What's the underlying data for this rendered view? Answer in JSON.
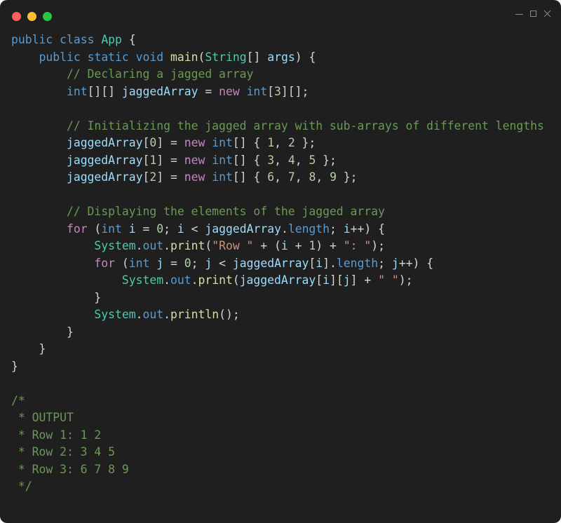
{
  "window": {
    "controls": {
      "close_color": "#ff5f57",
      "minimize_color": "#febc2e",
      "maximize_color": "#28c840"
    }
  },
  "code": {
    "language": "java",
    "lines": [
      [
        {
          "t": "public",
          "c": "kw"
        },
        {
          "t": " "
        },
        {
          "t": "class",
          "c": "kw"
        },
        {
          "t": " "
        },
        {
          "t": "App",
          "c": "type"
        },
        {
          "t": " {"
        }
      ],
      [
        {
          "t": "    "
        },
        {
          "t": "public",
          "c": "kw"
        },
        {
          "t": " "
        },
        {
          "t": "static",
          "c": "kw"
        },
        {
          "t": " "
        },
        {
          "t": "void",
          "c": "kw"
        },
        {
          "t": " "
        },
        {
          "t": "main",
          "c": "fn"
        },
        {
          "t": "("
        },
        {
          "t": "String",
          "c": "type"
        },
        {
          "t": "[] "
        },
        {
          "t": "args",
          "c": "var"
        },
        {
          "t": ") {"
        }
      ],
      [
        {
          "t": "        "
        },
        {
          "t": "// Declaring a jagged array",
          "c": "cm"
        }
      ],
      [
        {
          "t": "        "
        },
        {
          "t": "int",
          "c": "kw"
        },
        {
          "t": "[][] "
        },
        {
          "t": "jaggedArray",
          "c": "var"
        },
        {
          "t": " = "
        },
        {
          "t": "new",
          "c": "ctl"
        },
        {
          "t": " "
        },
        {
          "t": "int",
          "c": "kw"
        },
        {
          "t": "["
        },
        {
          "t": "3",
          "c": "num"
        },
        {
          "t": "][];"
        }
      ],
      [
        {
          "t": ""
        }
      ],
      [
        {
          "t": "        "
        },
        {
          "t": "// Initializing the jagged array with sub-arrays of different lengths",
          "c": "cm"
        }
      ],
      [
        {
          "t": "        "
        },
        {
          "t": "jaggedArray",
          "c": "var"
        },
        {
          "t": "["
        },
        {
          "t": "0",
          "c": "num"
        },
        {
          "t": "] = "
        },
        {
          "t": "new",
          "c": "ctl"
        },
        {
          "t": " "
        },
        {
          "t": "int",
          "c": "kw"
        },
        {
          "t": "[] { "
        },
        {
          "t": "1",
          "c": "num"
        },
        {
          "t": ", "
        },
        {
          "t": "2",
          "c": "num"
        },
        {
          "t": " };"
        }
      ],
      [
        {
          "t": "        "
        },
        {
          "t": "jaggedArray",
          "c": "var"
        },
        {
          "t": "["
        },
        {
          "t": "1",
          "c": "num"
        },
        {
          "t": "] = "
        },
        {
          "t": "new",
          "c": "ctl"
        },
        {
          "t": " "
        },
        {
          "t": "int",
          "c": "kw"
        },
        {
          "t": "[] { "
        },
        {
          "t": "3",
          "c": "num"
        },
        {
          "t": ", "
        },
        {
          "t": "4",
          "c": "num"
        },
        {
          "t": ", "
        },
        {
          "t": "5",
          "c": "num"
        },
        {
          "t": " };"
        }
      ],
      [
        {
          "t": "        "
        },
        {
          "t": "jaggedArray",
          "c": "var"
        },
        {
          "t": "["
        },
        {
          "t": "2",
          "c": "num"
        },
        {
          "t": "] = "
        },
        {
          "t": "new",
          "c": "ctl"
        },
        {
          "t": " "
        },
        {
          "t": "int",
          "c": "kw"
        },
        {
          "t": "[] { "
        },
        {
          "t": "6",
          "c": "num"
        },
        {
          "t": ", "
        },
        {
          "t": "7",
          "c": "num"
        },
        {
          "t": ", "
        },
        {
          "t": "8",
          "c": "num"
        },
        {
          "t": ", "
        },
        {
          "t": "9",
          "c": "num"
        },
        {
          "t": " };"
        }
      ],
      [
        {
          "t": ""
        }
      ],
      [
        {
          "t": "        "
        },
        {
          "t": "// Displaying the elements of the jagged array",
          "c": "cm"
        }
      ],
      [
        {
          "t": "        "
        },
        {
          "t": "for",
          "c": "ctl"
        },
        {
          "t": " ("
        },
        {
          "t": "int",
          "c": "kw"
        },
        {
          "t": " "
        },
        {
          "t": "i",
          "c": "var"
        },
        {
          "t": " = "
        },
        {
          "t": "0",
          "c": "num"
        },
        {
          "t": "; "
        },
        {
          "t": "i",
          "c": "var"
        },
        {
          "t": " < "
        },
        {
          "t": "jaggedArray",
          "c": "var"
        },
        {
          "t": "."
        },
        {
          "t": "length",
          "c": "kw"
        },
        {
          "t": "; "
        },
        {
          "t": "i",
          "c": "var"
        },
        {
          "t": "++) {"
        }
      ],
      [
        {
          "t": "            "
        },
        {
          "t": "System",
          "c": "type"
        },
        {
          "t": "."
        },
        {
          "t": "out",
          "c": "kw"
        },
        {
          "t": "."
        },
        {
          "t": "print",
          "c": "fn"
        },
        {
          "t": "("
        },
        {
          "t": "\"Row \"",
          "c": "str"
        },
        {
          "t": " + ("
        },
        {
          "t": "i",
          "c": "var"
        },
        {
          "t": " + "
        },
        {
          "t": "1",
          "c": "num"
        },
        {
          "t": ") + "
        },
        {
          "t": "\": \"",
          "c": "str"
        },
        {
          "t": ");"
        }
      ],
      [
        {
          "t": "            "
        },
        {
          "t": "for",
          "c": "ctl"
        },
        {
          "t": " ("
        },
        {
          "t": "int",
          "c": "kw"
        },
        {
          "t": " "
        },
        {
          "t": "j",
          "c": "var"
        },
        {
          "t": " = "
        },
        {
          "t": "0",
          "c": "num"
        },
        {
          "t": "; "
        },
        {
          "t": "j",
          "c": "var"
        },
        {
          "t": " < "
        },
        {
          "t": "jaggedArray",
          "c": "var"
        },
        {
          "t": "["
        },
        {
          "t": "i",
          "c": "var"
        },
        {
          "t": "]."
        },
        {
          "t": "length",
          "c": "kw"
        },
        {
          "t": "; "
        },
        {
          "t": "j",
          "c": "var"
        },
        {
          "t": "++) {"
        }
      ],
      [
        {
          "t": "                "
        },
        {
          "t": "System",
          "c": "type"
        },
        {
          "t": "."
        },
        {
          "t": "out",
          "c": "kw"
        },
        {
          "t": "."
        },
        {
          "t": "print",
          "c": "fn"
        },
        {
          "t": "("
        },
        {
          "t": "jaggedArray",
          "c": "var"
        },
        {
          "t": "["
        },
        {
          "t": "i",
          "c": "var"
        },
        {
          "t": "]["
        },
        {
          "t": "j",
          "c": "var"
        },
        {
          "t": "] + "
        },
        {
          "t": "\" \"",
          "c": "str"
        },
        {
          "t": ");"
        }
      ],
      [
        {
          "t": "            }"
        }
      ],
      [
        {
          "t": "            "
        },
        {
          "t": "System",
          "c": "type"
        },
        {
          "t": "."
        },
        {
          "t": "out",
          "c": "kw"
        },
        {
          "t": "."
        },
        {
          "t": "println",
          "c": "fn"
        },
        {
          "t": "();"
        }
      ],
      [
        {
          "t": "        }"
        }
      ],
      [
        {
          "t": "    }"
        }
      ],
      [
        {
          "t": "}"
        }
      ],
      [
        {
          "t": ""
        }
      ],
      [
        {
          "t": "/*",
          "c": "cm"
        }
      ],
      [
        {
          "t": " * OUTPUT",
          "c": "cm"
        }
      ],
      [
        {
          "t": " * Row 1: 1 2",
          "c": "cm"
        }
      ],
      [
        {
          "t": " * Row 2: 3 4 5",
          "c": "cm"
        }
      ],
      [
        {
          "t": " * Row 3: 6 7 8 9",
          "c": "cm"
        }
      ],
      [
        {
          "t": " */",
          "c": "cm"
        }
      ]
    ]
  }
}
